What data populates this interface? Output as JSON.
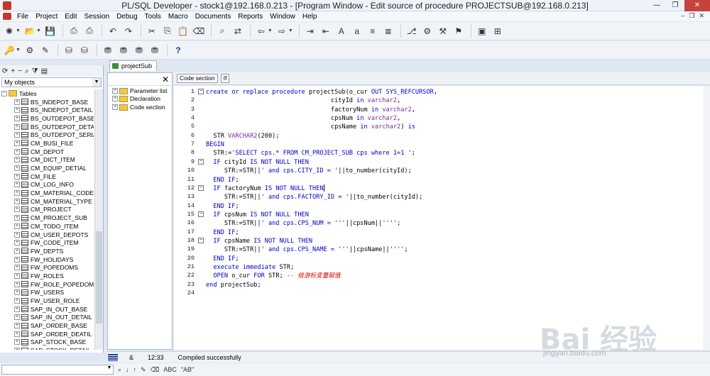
{
  "window": {
    "title": "PL/SQL Developer - stock1@192.168.0.213 - [Program Window - Edit source of procedure PROJECTSUB@192.168.0.213]"
  },
  "menu": [
    "File",
    "Project",
    "Edit",
    "Session",
    "Debug",
    "Tools",
    "Macro",
    "Documents",
    "Reports",
    "Window",
    "Help"
  ],
  "left_panel": {
    "selector_value": "My objects",
    "tree_root": "Tables",
    "tables": [
      "BS_INDEPOT_BASE",
      "BS_INDEPOT_DETAIL",
      "BS_OUTDEPOT_BASE",
      "BS_OUTDEPOT_DETA",
      "BS_OUTDEPOT_SERIA",
      "CM_BUSI_FILE",
      "CM_DEPOT",
      "CM_DICT_ITEM",
      "CM_EQUIP_DETIAL",
      "CM_FILE",
      "CM_LOG_INFO",
      "CM_MATERIAL_CODE",
      "CM_MATERIAL_TYPE",
      "CM_PROJECT",
      "CM_PROJECT_SUB",
      "CM_TODO_ITEM",
      "CM_USER_DEPOTS",
      "FW_CODE_ITEM",
      "FW_DEPTS",
      "FW_HOLIDAYS",
      "FW_POPEDOMS",
      "FW_ROLES",
      "FW_ROLE_POPEDOM",
      "FW_USERS",
      "FW_USER_ROLE",
      "SAP_IN_OUT_BASE",
      "SAP_IN_OUT_DETAIL",
      "SAP_ORDER_BASE",
      "SAP_ORDER_DEATIL",
      "SAP_STOCK_BASE",
      "SAP_STOCK_DETAIL"
    ]
  },
  "document_tab": "projectSub",
  "navigator": {
    "items": [
      "Parameter list",
      "Declaration",
      "Code section"
    ]
  },
  "editor_header": {
    "code_section": "Code section",
    "if_label": "If"
  },
  "editor": {
    "lines": [
      {
        "n": "1",
        "t": [
          [
            "kw",
            "create or replace procedure "
          ],
          [
            "id",
            "projectSub(o_cur "
          ],
          [
            "kw",
            "OUT SYS_REFCURSOR"
          ],
          [
            "id",
            ","
          ]
        ]
      },
      {
        "n": "2",
        "t": [
          [
            "id",
            "                                  cityId "
          ],
          [
            "kw",
            "in "
          ],
          [
            "tp",
            "varchar2"
          ],
          [
            "id",
            ","
          ]
        ]
      },
      {
        "n": "3",
        "t": [
          [
            "id",
            "                                  factoryNum "
          ],
          [
            "kw",
            "in "
          ],
          [
            "tp",
            "varchar2"
          ],
          [
            "id",
            ","
          ]
        ]
      },
      {
        "n": "4",
        "t": [
          [
            "id",
            "                                  cpsNum "
          ],
          [
            "kw",
            "in "
          ],
          [
            "tp",
            "varchar2"
          ],
          [
            "id",
            ","
          ]
        ]
      },
      {
        "n": "5",
        "t": [
          [
            "id",
            "                                  cpsName "
          ],
          [
            "kw",
            "in "
          ],
          [
            "tp",
            "varchar2"
          ],
          [
            "id",
            ") "
          ],
          [
            "kw",
            "is"
          ]
        ]
      },
      {
        "n": "6",
        "t": [
          [
            "id",
            "  STR "
          ],
          [
            "tp",
            "VARCHAR2"
          ],
          [
            "id",
            "(200);"
          ]
        ]
      },
      {
        "n": "7",
        "t": [
          [
            "kw",
            "BEGIN"
          ]
        ]
      },
      {
        "n": "8",
        "t": [
          [
            "id",
            "  STR:="
          ],
          [
            "str",
            "'SELECT cps.* FROM CM_PROJECT_SUB cps where 1=1 '"
          ],
          [
            "id",
            ";"
          ]
        ]
      },
      {
        "n": "9",
        "t": [
          [
            "kw",
            "  IF "
          ],
          [
            "id",
            "cityId "
          ],
          [
            "kw",
            "IS NOT NULL THEN"
          ]
        ]
      },
      {
        "n": "10",
        "t": [
          [
            "id",
            "     STR:=STR||"
          ],
          [
            "str",
            "' and cps.CITY_ID = '"
          ],
          [
            "id",
            "||to_number(cityId);"
          ]
        ]
      },
      {
        "n": "11",
        "t": [
          [
            "kw",
            "  END IF"
          ],
          [
            "id",
            ";"
          ]
        ]
      },
      {
        "n": "12",
        "t": [
          [
            "kw",
            "  IF "
          ],
          [
            "id",
            "factoryNum "
          ],
          [
            "kw",
            "IS NOT NULL THEN"
          ]
        ]
      },
      {
        "n": "13",
        "t": [
          [
            "id",
            "     STR:=STR||"
          ],
          [
            "str",
            "' and cps.FACTORY_ID = '"
          ],
          [
            "id",
            "||to_number(cityId);"
          ]
        ]
      },
      {
        "n": "14",
        "t": [
          [
            "kw",
            "  END IF"
          ],
          [
            "id",
            ";"
          ]
        ]
      },
      {
        "n": "15",
        "t": [
          [
            "kw",
            "  IF "
          ],
          [
            "id",
            "cpsNum "
          ],
          [
            "kw",
            "IS NOT NULL THEN"
          ]
        ]
      },
      {
        "n": "16",
        "t": [
          [
            "id",
            "     STR:=STR||"
          ],
          [
            "str",
            "' and cps.CPS_NUM = '''"
          ],
          [
            "id",
            "||cpsNum||"
          ],
          [
            "str",
            "''''"
          ],
          [
            "id",
            ";"
          ]
        ]
      },
      {
        "n": "17",
        "t": [
          [
            "kw",
            "  END IF"
          ],
          [
            "id",
            ";"
          ]
        ]
      },
      {
        "n": "18",
        "t": [
          [
            "kw",
            "  IF "
          ],
          [
            "id",
            "cpsName "
          ],
          [
            "kw",
            "IS NOT NULL THEN"
          ]
        ]
      },
      {
        "n": "19",
        "t": [
          [
            "id",
            "     STR:=STR||"
          ],
          [
            "str",
            "' and cps.CPS_NAME = '''"
          ],
          [
            "id",
            "||cpsName||"
          ],
          [
            "str",
            "''''"
          ],
          [
            "id",
            ";"
          ]
        ]
      },
      {
        "n": "20",
        "t": [
          [
            "kw",
            "  END IF"
          ],
          [
            "id",
            ";"
          ]
        ]
      },
      {
        "n": "21",
        "t": [
          [
            "kw",
            "  execute immediate "
          ],
          [
            "id",
            "STR;"
          ]
        ]
      },
      {
        "n": "22",
        "t": [
          [
            "kw",
            "  OPEN "
          ],
          [
            "id",
            "o_cur "
          ],
          [
            "kw",
            "FOR "
          ],
          [
            "id",
            "STR; "
          ],
          [
            "cm",
            "-- 给游标变量赋值"
          ]
        ]
      },
      {
        "n": "23",
        "t": [
          [
            "kw",
            "end "
          ],
          [
            "id",
            "projectSub;"
          ]
        ]
      },
      {
        "n": "24",
        "t": [
          [
            "id",
            ""
          ]
        ]
      }
    ]
  },
  "status": {
    "position": "12:33",
    "message": "Compiled successfully",
    "modified_marker": "&"
  },
  "bottombar": {
    "icons": [
      "binoculars-icon",
      "find-next-icon",
      "find-prev-icon",
      "highlight-icon",
      "clear-icon",
      "case-icon",
      "word-icon",
      "regex-icon"
    ],
    "labels": [
      "ABC",
      "\"AB\""
    ]
  },
  "watermark": {
    "text": "Bai 经验",
    "sub": "jingyan.baidu.com"
  },
  "colors": {
    "keyword": "#0000c8",
    "type": "#7a2b9a",
    "comment": "#d00000"
  }
}
